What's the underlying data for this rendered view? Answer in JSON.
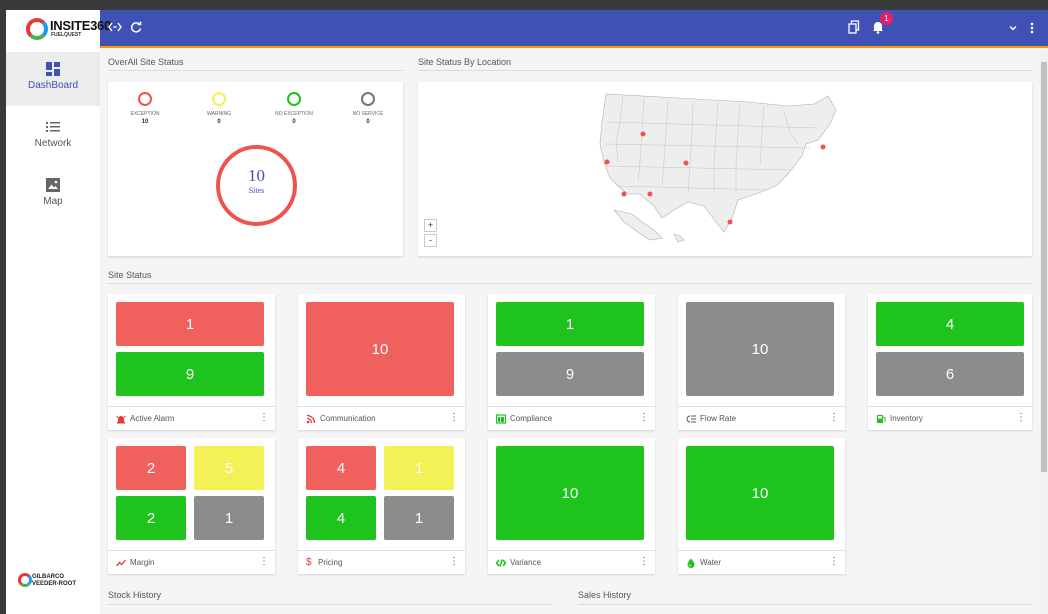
{
  "app": {
    "logo_text": "INSITE360",
    "logo_sub": "FUELQUEST",
    "notification_count": "1",
    "footer_logo_line1": "GILBARCO",
    "footer_logo_line2": "VEEDER-ROOT"
  },
  "sidebar": {
    "items": [
      {
        "label": "DashBoard",
        "icon": "dashboard-icon",
        "active": true
      },
      {
        "label": "Network",
        "icon": "list-icon",
        "active": false
      },
      {
        "label": "Map",
        "icon": "image-icon",
        "active": false
      }
    ]
  },
  "overall": {
    "title": "OverAll Site Status",
    "statuses": [
      {
        "label": "EXCEPTION",
        "count": "10",
        "color": "#ef5350"
      },
      {
        "label": "WARNING",
        "count": "0",
        "color": "#f2f257"
      },
      {
        "label": "NO EXCEPTION",
        "count": "0",
        "color": "#1ec31e"
      },
      {
        "label": "NO SERVICE",
        "count": "0",
        "color": "#757575"
      }
    ],
    "total": "10",
    "total_label": "Sites"
  },
  "location": {
    "title": "Site Status By Location",
    "zoom_in": "+",
    "zoom_out": "-"
  },
  "site_status": {
    "title": "Site Status",
    "cards": [
      {
        "name": "Active Alarm",
        "tiles": [
          "1",
          "9"
        ]
      },
      {
        "name": "Communication",
        "tiles": [
          "10"
        ]
      },
      {
        "name": "Compliance",
        "tiles": [
          "1",
          "9"
        ]
      },
      {
        "name": "Flow Rate",
        "tiles": [
          "10"
        ]
      },
      {
        "name": "Inventory",
        "tiles": [
          "4",
          "6"
        ]
      },
      {
        "name": "Margin",
        "tiles": [
          "2",
          "5",
          "2",
          "1"
        ]
      },
      {
        "name": "Pricing",
        "tiles": [
          "4",
          "1",
          "4",
          "1"
        ]
      },
      {
        "name": "Variance",
        "tiles": [
          "10"
        ]
      },
      {
        "name": "Water",
        "tiles": [
          "10"
        ]
      }
    ]
  },
  "bottom": {
    "stock_history": "Stock History",
    "sales_history": "Sales History"
  }
}
